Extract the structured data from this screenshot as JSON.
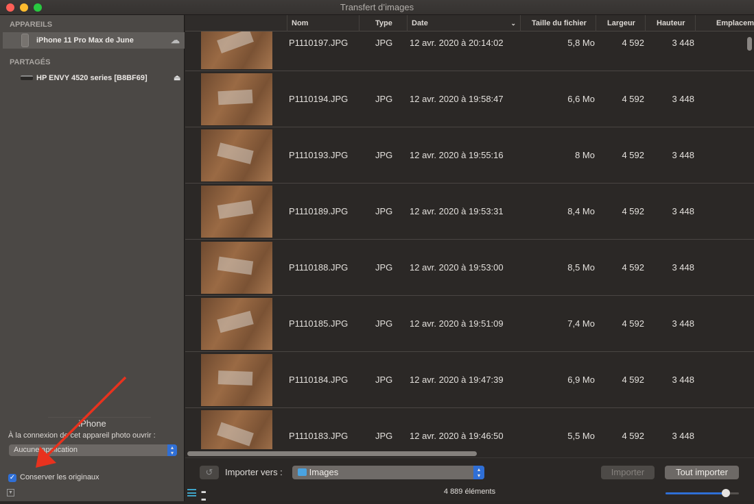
{
  "window": {
    "title": "Transfert d’images"
  },
  "sidebar": {
    "devices_header": "APPAREILS",
    "devices": [
      {
        "label": "iPhone 11 Pro Max de June",
        "icon": "cloud-icon"
      }
    ],
    "shared_header": "PARTAGÉS",
    "shared": [
      {
        "label": "HP ENVY 4520 series [B8BF69]",
        "icon": "eject-icon"
      }
    ],
    "device_name": "iPhone",
    "open_label": "À la connexion de cet appareil photo ouvrir :",
    "open_app": "Aucune application",
    "keep_originals_label": "Conserver les originaux",
    "keep_originals": true
  },
  "table": {
    "columns": [
      "Nom",
      "Type",
      "Date",
      "Taille du fichier",
      "Largeur",
      "Hauteur",
      "Emplacement"
    ],
    "rows": [
      {
        "name": "P1110197.JPG",
        "type": "JPG",
        "date": "12 avr. 2020 à 20:14:02",
        "size": "5,8 Mo",
        "width": "4 592",
        "height": "3 448"
      },
      {
        "name": "P1110194.JPG",
        "type": "JPG",
        "date": "12 avr. 2020 à 19:58:47",
        "size": "6,6 Mo",
        "width": "4 592",
        "height": "3 448"
      },
      {
        "name": "P1110193.JPG",
        "type": "JPG",
        "date": "12 avr. 2020 à 19:55:16",
        "size": "8 Mo",
        "width": "4 592",
        "height": "3 448"
      },
      {
        "name": "P1110189.JPG",
        "type": "JPG",
        "date": "12 avr. 2020 à 19:53:31",
        "size": "8,4 Mo",
        "width": "4 592",
        "height": "3 448"
      },
      {
        "name": "P1110188.JPG",
        "type": "JPG",
        "date": "12 avr. 2020 à 19:53:00",
        "size": "8,5 Mo",
        "width": "4 592",
        "height": "3 448"
      },
      {
        "name": "P1110185.JPG",
        "type": "JPG",
        "date": "12 avr. 2020 à 19:51:09",
        "size": "7,4 Mo",
        "width": "4 592",
        "height": "3 448"
      },
      {
        "name": "P1110184.JPG",
        "type": "JPG",
        "date": "12 avr. 2020 à 19:47:39",
        "size": "6,9 Mo",
        "width": "4 592",
        "height": "3 448"
      },
      {
        "name": "P1110183.JPG",
        "type": "JPG",
        "date": "12 avr. 2020 à 19:46:50",
        "size": "5,5 Mo",
        "width": "4 592",
        "height": "3 448"
      }
    ]
  },
  "footer": {
    "import_to_label": "Importer vers :",
    "destination": "Images",
    "import_label": "Importer",
    "import_all_label": "Tout importer",
    "count": "4 889 éléments",
    "thumb_size_fraction": 0.82
  },
  "colors": {
    "accent": "#2f6fd6",
    "annotation_arrow": "#e8321e"
  }
}
